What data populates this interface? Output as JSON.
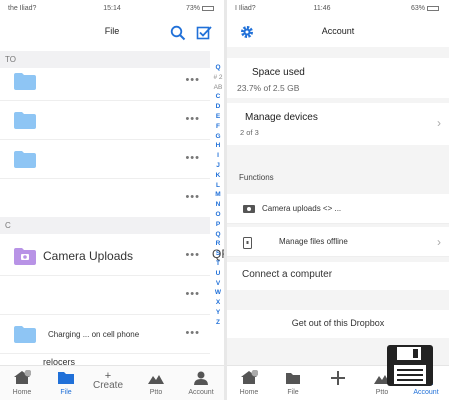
{
  "left": {
    "status": {
      "carrier": "the Iliad?",
      "time": "15:14",
      "battery": "73%"
    },
    "header": {
      "title": "File"
    },
    "section_to": "TO",
    "section_c": "C",
    "rows": [
      {
        "name": ""
      },
      {
        "name": ""
      },
      {
        "name": ""
      },
      {
        "name": ""
      },
      {
        "name": "Camera Uploads"
      },
      {
        "name": ""
      },
      {
        "name": "Charging ... on cell phone"
      },
      {
        "name": "relocers"
      }
    ],
    "alphabet": [
      "Q",
      "# 2",
      "AB",
      "C",
      "D",
      "E",
      "F",
      "G",
      "H",
      "I",
      "J",
      "K",
      "L",
      "M",
      "N",
      "O",
      "P",
      "Q",
      "R",
      "S",
      "T",
      "U",
      "V",
      "W",
      "X",
      "Y",
      "Z"
    ],
    "qr": "QR",
    "tabs": [
      {
        "label": "Home",
        "badge": "1"
      },
      {
        "label": "File"
      },
      {
        "label": "Create",
        "plus": "+"
      },
      {
        "label": "Ptto"
      },
      {
        "label": "Account"
      }
    ]
  },
  "right": {
    "status": {
      "carrier": "I Iliad?",
      "time": "11:46",
      "battery": "63%"
    },
    "header": {
      "title": "Account"
    },
    "space": {
      "label": "Space used",
      "value": "23.7% of 2.5 GB"
    },
    "devices": {
      "label": "Manage devices",
      "value": "2 of 3"
    },
    "functions_label": "Functions",
    "camera_uploads": "Camera uploads <> ...",
    "offline": "Manage files offline",
    "connect": "Connect a computer",
    "logout": "Get out of this Dropbox",
    "tabs": [
      {
        "label": "Home",
        "badge": "2"
      },
      {
        "label": "File"
      },
      {
        "label": ""
      },
      {
        "label": "Ptto"
      },
      {
        "label": "Account"
      }
    ]
  },
  "colors": {
    "accent": "#2070d8",
    "folder": "#8ec5f4",
    "camera_folder": "#b893e6"
  }
}
